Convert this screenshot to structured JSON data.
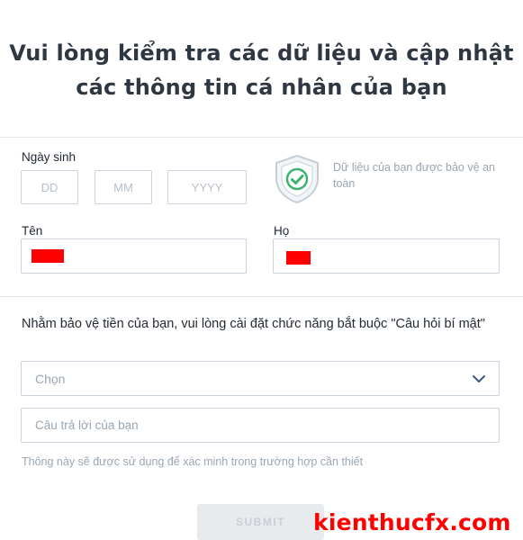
{
  "header": {
    "title_line1": "Vui lòng kiểm tra các dữ liệu và cập nhật",
    "title_line2": "các thông tin cá nhân của bạn"
  },
  "birthdate": {
    "label": "Ngày sinh",
    "day_placeholder": "DD",
    "month_placeholder": "MM",
    "year_placeholder": "YYYY"
  },
  "security_note": "Dữ liệu của bạn được bảo vệ an toàn",
  "name": {
    "first_label": "Tên",
    "last_label": "Họ"
  },
  "secret_question": {
    "prompt": "Nhằm bảo vệ tiền của bạn, vui lòng cài đặt chức năng bắt buộc \"Câu hỏi bí mật\"",
    "select_placeholder": "Chọn",
    "answer_placeholder": "Câu trả lời của bạn",
    "hint": "Thông này sẽ được sử dụng để xác minh trong trường hợp cần thiết"
  },
  "submit_label": "SUBMIT",
  "watermark": "kienthucfx.com",
  "colors": {
    "redaction": "#ff0000",
    "shield_green": "#3cb371",
    "border": "#c9d3de"
  }
}
